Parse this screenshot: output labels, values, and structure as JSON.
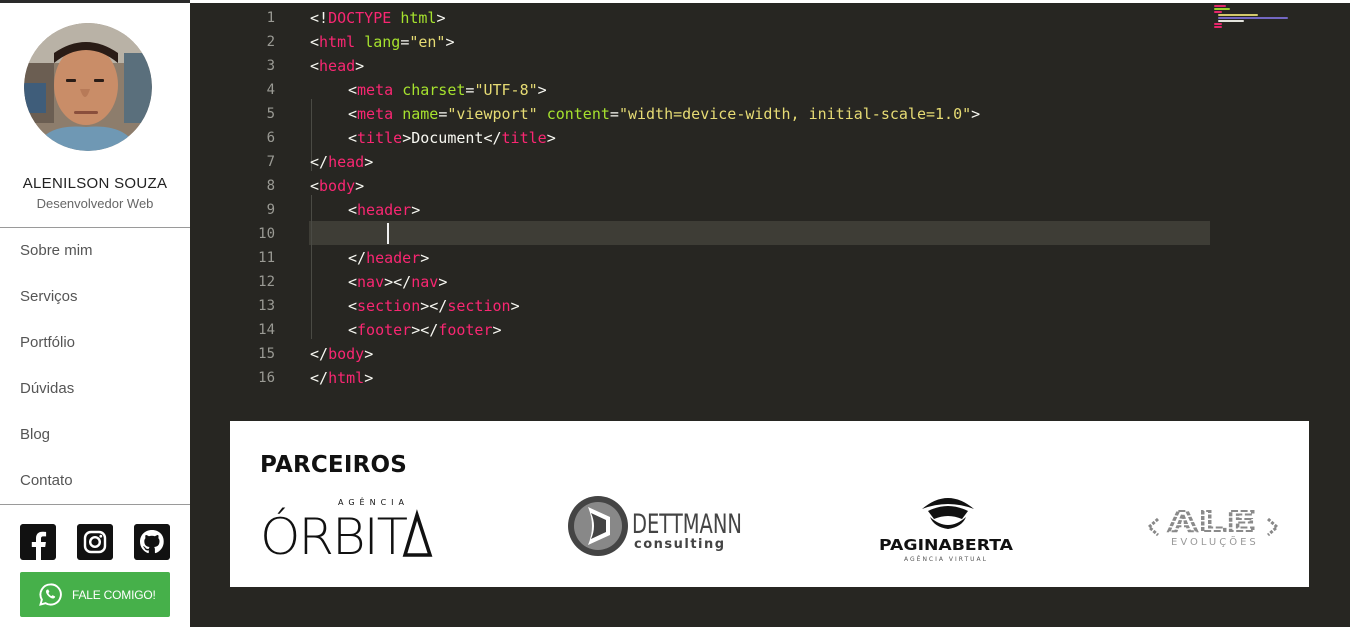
{
  "profile": {
    "name": "ALENILSON SOUZA",
    "role": "Desenvolvedor Web"
  },
  "nav": {
    "items": [
      {
        "label": "Sobre mim"
      },
      {
        "label": "Serviços"
      },
      {
        "label": "Portfólio"
      },
      {
        "label": "Dúvidas"
      },
      {
        "label": "Blog"
      },
      {
        "label": "Contato"
      }
    ]
  },
  "social": {
    "icons": [
      "facebook-icon",
      "instagram-icon",
      "github-icon"
    ]
  },
  "whatsapp": {
    "label": "FALE COMIGO!",
    "color": "#46b04a"
  },
  "editor": {
    "theme": {
      "background": "#272622",
      "tag": "#f92672",
      "attribute": "#a6e22e",
      "string": "#e6db74",
      "text": "#f8f8f2"
    },
    "current_line": 10,
    "lines": [
      {
        "n": "1",
        "indent": 0,
        "tokens": [
          [
            "p",
            "<!"
          ],
          [
            "t",
            "DOCTYPE"
          ],
          [
            "p",
            " "
          ],
          [
            "a",
            "html"
          ],
          [
            "p",
            ">"
          ]
        ]
      },
      {
        "n": "2",
        "indent": 0,
        "tokens": [
          [
            "p",
            "<"
          ],
          [
            "t",
            "html"
          ],
          [
            "p",
            " "
          ],
          [
            "a",
            "lang"
          ],
          [
            "p",
            "="
          ],
          [
            "s",
            "\"en\""
          ],
          [
            "p",
            ">"
          ]
        ]
      },
      {
        "n": "3",
        "indent": 0,
        "tokens": [
          [
            "p",
            "<"
          ],
          [
            "t",
            "head"
          ],
          [
            "p",
            ">"
          ]
        ]
      },
      {
        "n": "4",
        "indent": 1,
        "tokens": [
          [
            "p",
            "<"
          ],
          [
            "t",
            "meta"
          ],
          [
            "p",
            " "
          ],
          [
            "a",
            "charset"
          ],
          [
            "p",
            "="
          ],
          [
            "s",
            "\"UTF-8\""
          ],
          [
            "p",
            ">"
          ]
        ]
      },
      {
        "n": "5",
        "indent": 1,
        "tokens": [
          [
            "p",
            "<"
          ],
          [
            "t",
            "meta"
          ],
          [
            "p",
            " "
          ],
          [
            "a",
            "name"
          ],
          [
            "p",
            "="
          ],
          [
            "s",
            "\"viewport\""
          ],
          [
            "p",
            " "
          ],
          [
            "a",
            "content"
          ],
          [
            "p",
            "="
          ],
          [
            "s",
            "\"width=device-width, initial-scale=1.0\""
          ],
          [
            "p",
            ">"
          ]
        ]
      },
      {
        "n": "6",
        "indent": 1,
        "tokens": [
          [
            "p",
            "<"
          ],
          [
            "t",
            "title"
          ],
          [
            "p",
            ">Document</"
          ],
          [
            "t",
            "title"
          ],
          [
            "p",
            ">"
          ]
        ]
      },
      {
        "n": "7",
        "indent": 0,
        "tokens": [
          [
            "p",
            "</"
          ],
          [
            "t",
            "head"
          ],
          [
            "p",
            ">"
          ]
        ]
      },
      {
        "n": "8",
        "indent": 0,
        "tokens": [
          [
            "p",
            "<"
          ],
          [
            "t",
            "body"
          ],
          [
            "p",
            ">"
          ]
        ]
      },
      {
        "n": "9",
        "indent": 1,
        "tokens": [
          [
            "p",
            "<"
          ],
          [
            "t",
            "header"
          ],
          [
            "p",
            ">"
          ]
        ]
      },
      {
        "n": "10",
        "indent": 2,
        "tokens": []
      },
      {
        "n": "11",
        "indent": 1,
        "tokens": [
          [
            "p",
            "</"
          ],
          [
            "t",
            "header"
          ],
          [
            "p",
            ">"
          ]
        ]
      },
      {
        "n": "12",
        "indent": 1,
        "tokens": [
          [
            "p",
            "<"
          ],
          [
            "t",
            "nav"
          ],
          [
            "p",
            "></"
          ],
          [
            "t",
            "nav"
          ],
          [
            "p",
            ">"
          ]
        ]
      },
      {
        "n": "13",
        "indent": 1,
        "tokens": [
          [
            "p",
            "<"
          ],
          [
            "t",
            "section"
          ],
          [
            "p",
            "></"
          ],
          [
            "t",
            "section"
          ],
          [
            "p",
            ">"
          ]
        ]
      },
      {
        "n": "14",
        "indent": 1,
        "tokens": [
          [
            "p",
            "<"
          ],
          [
            "t",
            "footer"
          ],
          [
            "p",
            "></"
          ],
          [
            "t",
            "footer"
          ],
          [
            "p",
            ">"
          ]
        ]
      },
      {
        "n": "15",
        "indent": 0,
        "tokens": [
          [
            "p",
            "</"
          ],
          [
            "t",
            "body"
          ],
          [
            "p",
            ">"
          ]
        ]
      },
      {
        "n": "16",
        "indent": 0,
        "tokens": [
          [
            "p",
            "</"
          ],
          [
            "t",
            "html"
          ],
          [
            "p",
            ">"
          ]
        ]
      }
    ]
  },
  "partners": {
    "title": "PARCEIROS",
    "logos": [
      {
        "name": "orbita-logo",
        "word": "ÓRBITA",
        "tagline": "AGÊNCIA"
      },
      {
        "name": "dettmann-logo",
        "word": "DETTMANN",
        "tagline": "consulting"
      },
      {
        "name": "paginaberta-logo",
        "word": "PAGINABERTA",
        "tagline": "AGÊNCIA VIRTUAL"
      },
      {
        "name": "ale-logo",
        "word": "ALE",
        "tagline": "EVOLUÇÕES"
      }
    ]
  }
}
